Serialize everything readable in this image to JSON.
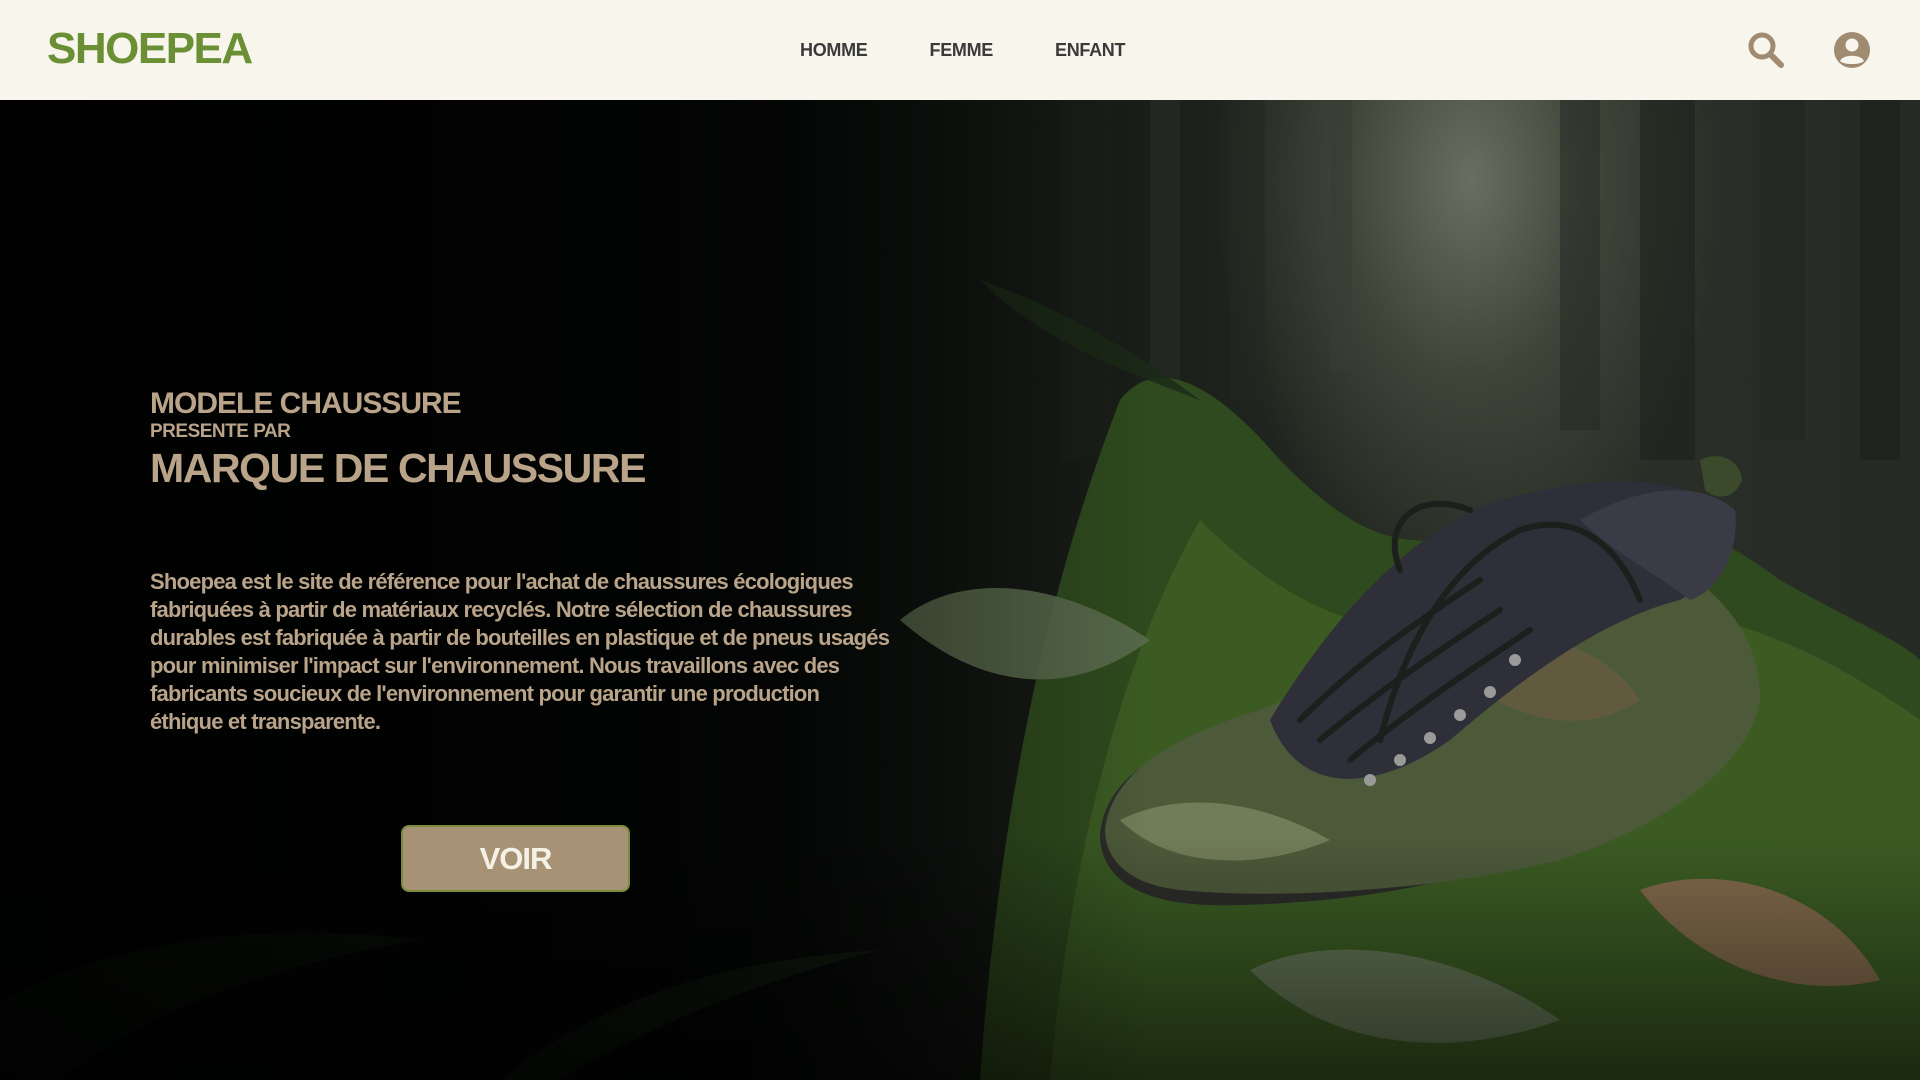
{
  "header": {
    "logo": "SHOEPEA",
    "nav": [
      "HOMME",
      "FEMME",
      "ENFANT"
    ],
    "icons": [
      "search-icon",
      "account-icon"
    ]
  },
  "hero": {
    "model_label": "MODELE CHAUSSURE",
    "presented_by": "PRESENTE PAR",
    "brand_label": "MARQUE DE CHAUSSURE",
    "description": "Shoepea est le site de référence pour l'achat de chaussures écologiques fabriquées à partir de matériaux recyclés. Notre sélection de chaussures durables est fabriquée à partir de bouteilles en plastique et de pneus usagés pour minimiser l'impact sur l'environnement. Nous travaillons avec des fabricants soucieux de l'environnement pour garantir une production éthique et transparente.",
    "cta_label": "VOIR"
  },
  "colors": {
    "logo": "#6a8f35",
    "header_bg": "#f8f5ec",
    "text_beige": "#b9a48a",
    "button_bg": "#a89276",
    "button_border": "#7a8c3e",
    "icon": "#a08a70"
  }
}
